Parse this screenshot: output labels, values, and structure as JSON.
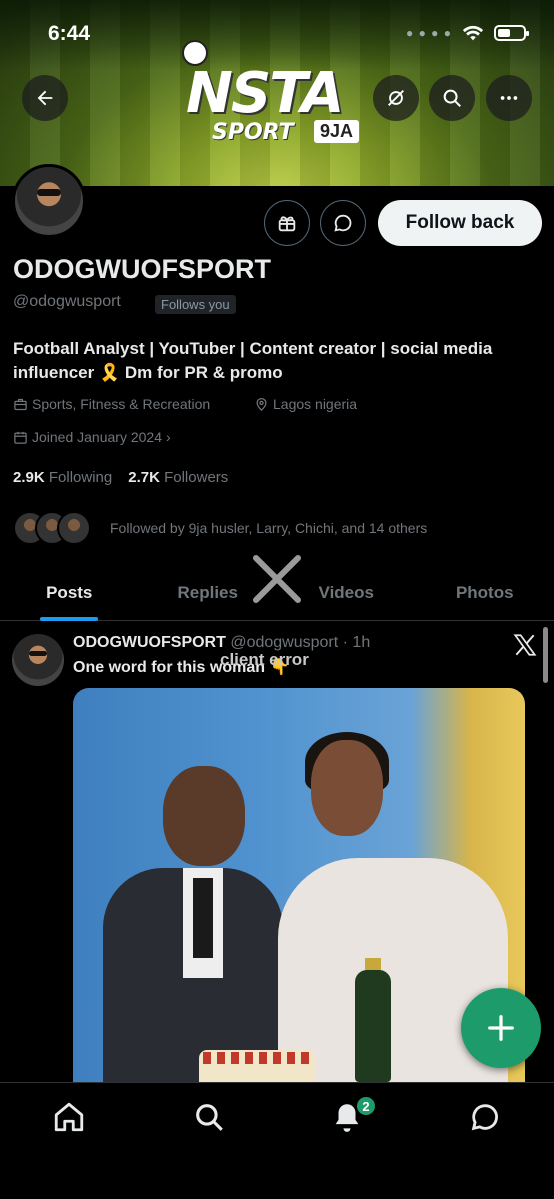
{
  "status_bar": {
    "time": "6:44"
  },
  "banner": {
    "logo_line1": "NSTA",
    "logo_line2": "SPORT",
    "logo_tag": "9JA"
  },
  "profile": {
    "display_name": "ODOGWUOFSPORT",
    "handle": "@odogwusport",
    "follows_you": "Follows you",
    "bio": "Football Analyst | YouTuber | Content creator | social media influencer 🎗️ Dm for PR & promo",
    "category": "Sports, Fitness & Recreation",
    "location": "Lagos nigeria",
    "joined": "Joined January 2024",
    "following_count": "2.9K",
    "following_label": "Following",
    "followers_count": "2.7K",
    "followers_label": "Followers",
    "followed_by": "Followed by 9ja husler, Larry, Chichi, and 14 others",
    "follow_back_label": "Follow back"
  },
  "tabs": [
    {
      "label": "Posts",
      "active": true
    },
    {
      "label": "Replies",
      "active": false
    },
    {
      "label": "Videos",
      "active": false
    },
    {
      "label": "Photos",
      "active": false
    }
  ],
  "post": {
    "author_name": "ODOGWUOFSPORT",
    "author_handle": "@odogwusport",
    "time": "· 1h",
    "text": "One word for this woman 👇",
    "overlay_error": "client error"
  },
  "bottom_nav": {
    "notifications_badge": "2"
  },
  "colors": {
    "accent": "#1d9bf0",
    "fab": "#1d9b6a",
    "background": "#000000"
  }
}
